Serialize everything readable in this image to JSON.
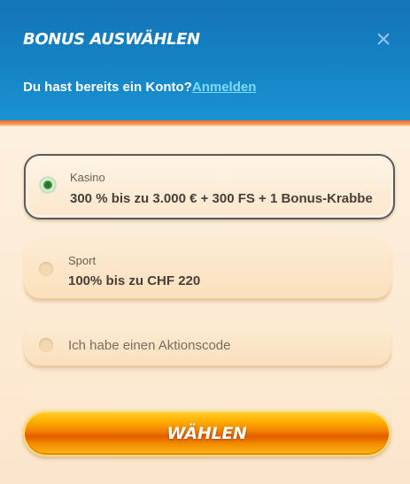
{
  "header": {
    "title": "BONUS AUSWÄHLEN",
    "account_text": "Du hast bereits ein Konto?",
    "login_link": "Anmelden",
    "close_icon": "×"
  },
  "options": [
    {
      "category": "Kasino",
      "offer": "300 % bis zu 3.000 € + 300 FS + 1 Bonus-Krabbe",
      "selected": true
    },
    {
      "category": "Sport",
      "offer": "100% bis zu CHF 220",
      "selected": false
    },
    {
      "label": "Ich habe einen Aktionscode",
      "selected": false
    }
  ],
  "submit_label": "WÄHLEN",
  "colors": {
    "header_blue": "#1685c6",
    "link": "#7fdcff",
    "selected_radio": "#3f8f3c",
    "button_orange": "#f07e00"
  }
}
